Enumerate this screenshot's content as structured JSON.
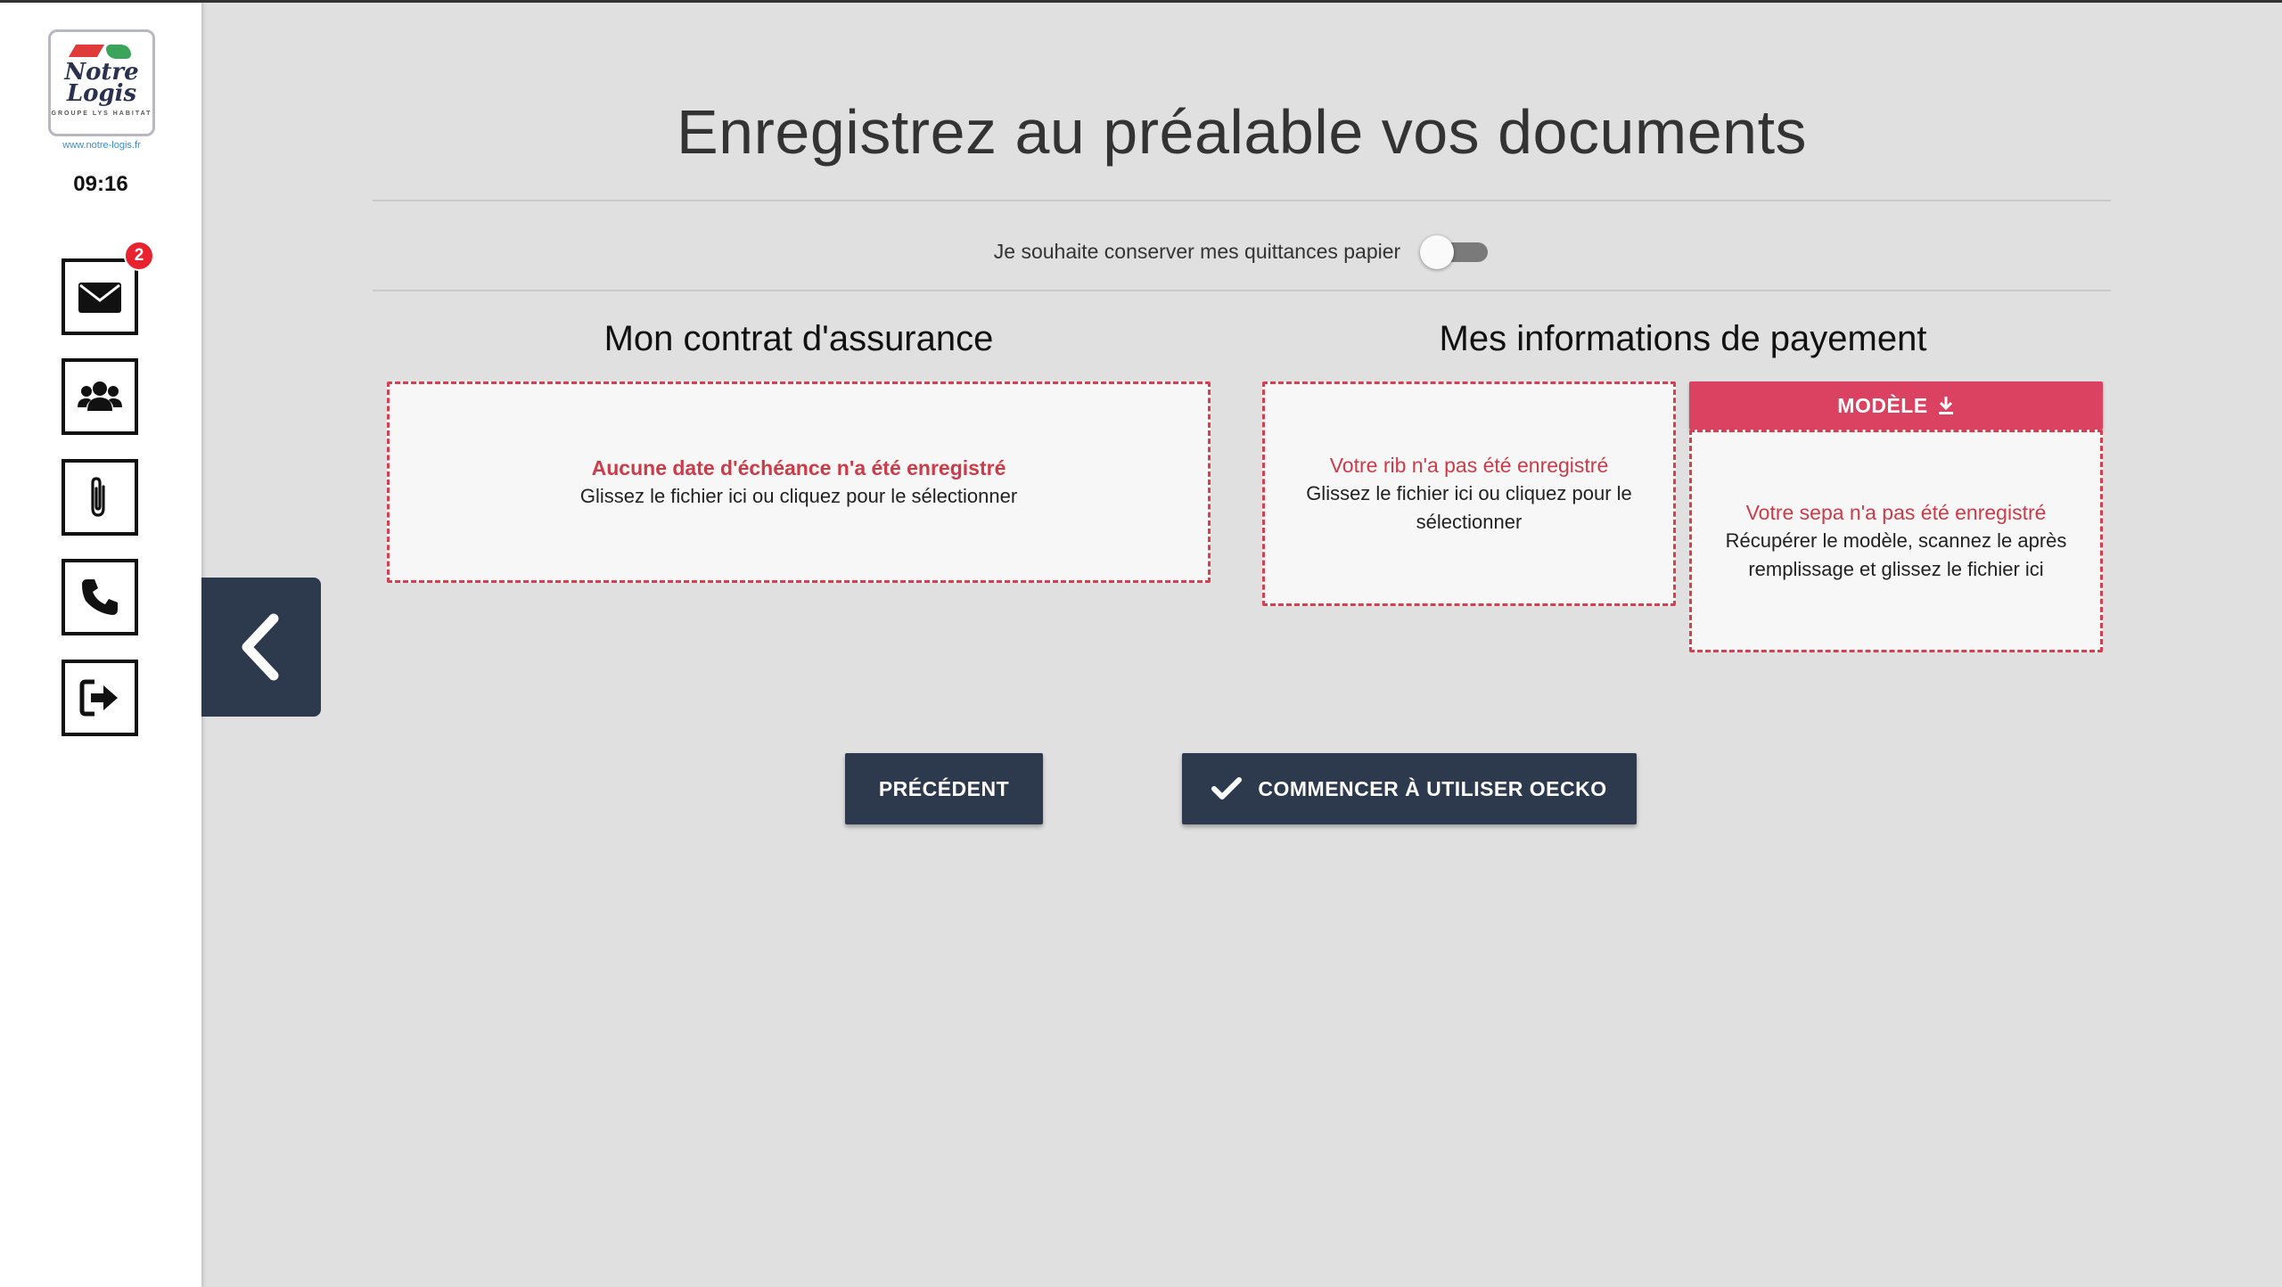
{
  "sidebar": {
    "logo": {
      "line1": "Notre",
      "line2": "Logis",
      "line3": "GROUPE LYS HABITAT",
      "url": "www.notre-logis.fr"
    },
    "clock": "09:16",
    "items": [
      {
        "name": "messages",
        "icon": "envelope-icon",
        "badge": "2"
      },
      {
        "name": "contacts",
        "icon": "users-icon"
      },
      {
        "name": "documents",
        "icon": "paperclip-icon"
      },
      {
        "name": "phone",
        "icon": "phone-icon"
      },
      {
        "name": "logout",
        "icon": "sign-out-icon"
      }
    ]
  },
  "page": {
    "title": "Enregistrez au préalable vos documents",
    "toggle": {
      "label": "Je souhaite conserver mes quittances papier",
      "checked": false
    }
  },
  "insurance": {
    "title": "Mon contrat d'assurance",
    "error": "Aucune date d'échéance n'a été enregistré",
    "hint": "Glissez le fichier ici ou cliquez pour le sélectionner"
  },
  "payment": {
    "title": "Mes informations de payement",
    "rib": {
      "error": "Votre rib n'a pas été enregistré",
      "hint": "Glissez le fichier ici ou cliquez pour le sélectionner"
    },
    "model_button": "MODÈLE",
    "sepa": {
      "error": "Votre sepa n'a pas été enregistré",
      "hint": "Récupérer le modèle, scannez le après remplissage et glissez le fichier ici"
    }
  },
  "actions": {
    "previous": "PRÉCÉDENT",
    "start": "COMMENCER À UTILISER OECKO"
  },
  "colors": {
    "accent": "#db4262",
    "dark": "#2d3a4e",
    "error": "#cc3b48",
    "background": "#e0e0e0"
  }
}
